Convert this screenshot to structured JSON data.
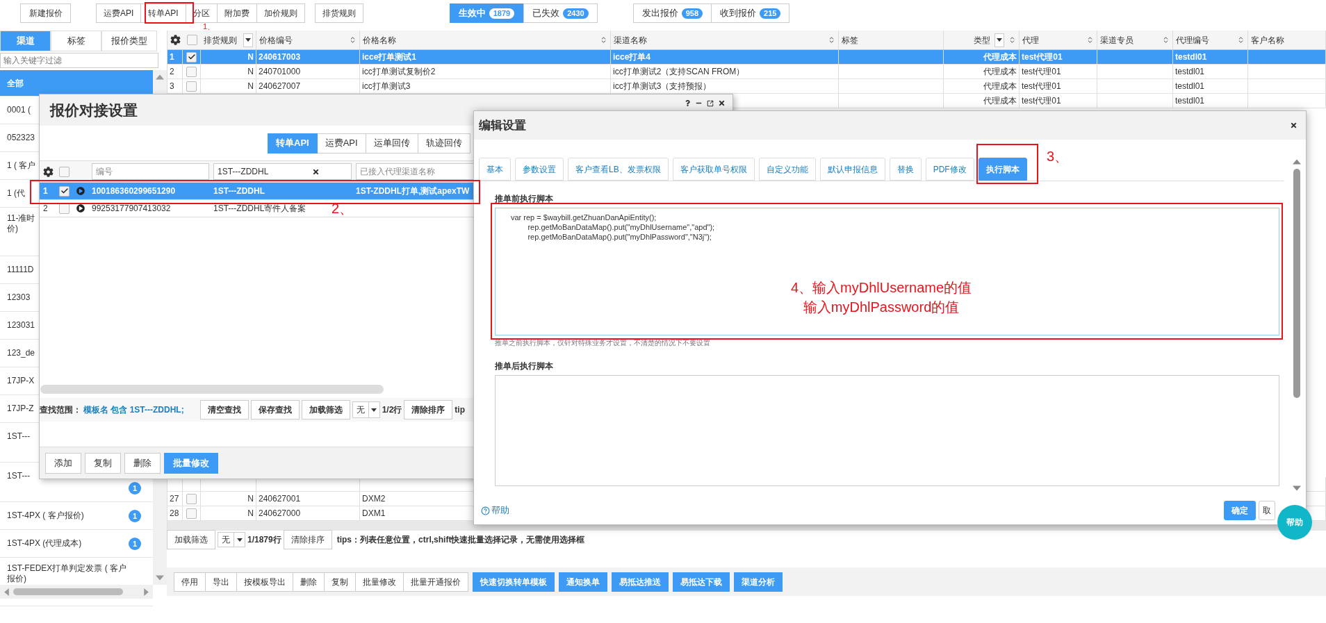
{
  "toolbar": {
    "new_button": "新建报价",
    "api_group": [
      "运费API",
      "转单API",
      "分区",
      "附加费",
      "加价规则"
    ],
    "rules_button": "排货规则",
    "status_toggle": [
      {
        "label": "生效中",
        "count": "1879",
        "selected": true
      },
      {
        "label": "已失效",
        "count": "2430",
        "selected": false
      }
    ],
    "direction_toggle": [
      {
        "label": "发出报价",
        "count": "958"
      },
      {
        "label": "收到报价",
        "count": "215"
      }
    ]
  },
  "sidebar": {
    "tabs": [
      {
        "label": "渠道",
        "selected": true
      },
      {
        "label": "标签",
        "selected": false
      },
      {
        "label": "报价类型",
        "selected": false
      }
    ],
    "filter_placeholder": "输入关键字过滤",
    "items": [
      {
        "lines": [
          "全部"
        ],
        "selected": true
      },
      {
        "lines": [
          "0001 ("
        ],
        "selected": false
      },
      {
        "lines": [
          "052323"
        ],
        "selected": false
      },
      {
        "lines": [
          "1 ( 客户"
        ],
        "selected": false
      },
      {
        "lines": [
          "1 (代"
        ],
        "selected": false
      },
      {
        "lines": [
          "11-准时",
          "价)"
        ],
        "selected": false
      },
      {
        "lines": [
          "11111D"
        ],
        "selected": false
      },
      {
        "lines": [
          "12303"
        ],
        "selected": false
      },
      {
        "lines": [
          "123031"
        ],
        "selected": false
      },
      {
        "lines": [
          "123_de"
        ],
        "selected": false
      },
      {
        "lines": [
          "17JP-X"
        ],
        "selected": false
      },
      {
        "lines": [
          "17JP-Z"
        ],
        "selected": false
      },
      {
        "lines": [
          "1ST---"
        ],
        "selected": false
      },
      {
        "lines": [
          "1ST---"
        ],
        "selected": false,
        "badge": "1"
      },
      {
        "lines": [
          "1ST-4PX ( 客户报价)"
        ],
        "selected": false,
        "badge": "1"
      },
      {
        "lines": [
          "1ST-4PX (代理成本)"
        ],
        "selected": false,
        "badge": "1"
      },
      {
        "lines": [
          "1ST-FEDEX打单判定发票 ( 客户",
          "报价)"
        ],
        "selected": false
      }
    ]
  },
  "main_table": {
    "columns": [
      {
        "label": "排货规则",
        "kind": "filter"
      },
      {
        "label": "价格编号",
        "kind": "sort"
      },
      {
        "label": "价格名称",
        "kind": "sort"
      },
      {
        "label": "渠道名称",
        "kind": "sort"
      },
      {
        "label": "标签",
        "kind": "plain"
      },
      {
        "label": "类型",
        "kind": "filter_sort"
      },
      {
        "label": "代理",
        "kind": "sort"
      },
      {
        "label": "渠道专员",
        "kind": "sort"
      },
      {
        "label": "代理编号",
        "kind": "sort"
      },
      {
        "label": "客户名称",
        "kind": "plain"
      }
    ],
    "rows": [
      {
        "num": "1",
        "checked": true,
        "selected": true,
        "cells": [
          "N",
          "240617003",
          "icce打单测试1",
          "icce打单4",
          null,
          "代理成本",
          "test代理01",
          null,
          "testdl01",
          null
        ]
      },
      {
        "num": "2",
        "checked": false,
        "selected": false,
        "cells": [
          "N",
          "240701000",
          "icc打单测试复制价2",
          "icc打单测试2（支持SCAN FROM）",
          null,
          "代理成本",
          "test代理01",
          null,
          "testdl01",
          null
        ]
      },
      {
        "num": "3",
        "checked": false,
        "selected": false,
        "cells": [
          "N",
          "240627007",
          "icc打单测试3",
          "icc打单测试3（支持预报）",
          null,
          "代理成本",
          "test代理01",
          null,
          "testdl01",
          null
        ]
      },
      {
        "selected": false,
        "cells": [
          null,
          null,
          null,
          null,
          null,
          "代理成本",
          "test代理01",
          null,
          "testdl01",
          null
        ]
      }
    ],
    "header_checked": false,
    "lower_rows": [
      {
        "selected": false,
        "cells": []
      },
      {
        "num": "27",
        "checked": false,
        "selected": false,
        "cells": [
          "N",
          "240627001",
          "DXM2"
        ]
      },
      {
        "num": "28",
        "checked": false,
        "selected": false,
        "cells": [
          "N",
          "240627000",
          "DXM1"
        ]
      }
    ]
  },
  "main_footer": {
    "filter_button": "加载筛选",
    "select": "无",
    "row_count": "1/1879行",
    "sort_button": "清除排序",
    "tips": "tips：列表任意位置，ctrl,shift快速批量选择记录，无需使用选择框"
  },
  "bottom_buttons": [
    {
      "label": "停用",
      "primary": false
    },
    {
      "label": "导出",
      "primary": false
    },
    {
      "label": "按模板导出",
      "primary": false
    },
    {
      "label": "删除",
      "primary": false
    },
    {
      "label": "复制",
      "primary": false
    },
    {
      "label": "批量修改",
      "primary": false
    },
    {
      "label": "批量开通报价",
      "primary": false
    },
    {
      "label": "快速切换转单模板",
      "primary": true
    },
    {
      "label": "通知换单",
      "primary": true
    },
    {
      "label": "易抵达推送",
      "primary": true
    },
    {
      "label": "易抵达下载",
      "primary": true
    },
    {
      "label": "渠道分析",
      "primary": true
    }
  ],
  "quote_dialog": {
    "title": "报价对接设置",
    "tabs": [
      {
        "label": "转单API",
        "selected": true
      },
      {
        "label": "运费API",
        "selected": false
      },
      {
        "label": "运单回传",
        "selected": false
      },
      {
        "label": "轨迹回传",
        "selected": false
      }
    ],
    "header_checked": false,
    "filters": [
      {
        "placeholder": "编号"
      },
      {
        "value": "1ST---ZDDHL"
      },
      {
        "placeholder": "已接入代理渠道名称"
      }
    ],
    "rows": [
      {
        "num": "1",
        "checked": true,
        "selected": true,
        "cells": [
          "100186360299651290",
          "1ST---ZDDHL",
          "1ST-ZDDHL打单,测试apexTW"
        ]
      },
      {
        "num": "2",
        "checked": false,
        "selected": false,
        "cells": [
          "99253177907413032",
          "1ST---ZDDHL寄件人备案",
          null
        ]
      }
    ],
    "search_label": "查找范围：",
    "search_value": "模板名 包含 1ST---ZDDHL;",
    "search_buttons": [
      "清空查找",
      "保存查找",
      "加载筛选"
    ],
    "select": "无",
    "row_count": "1/2行",
    "sort_button": "清除排序",
    "tips": "tip",
    "footer_buttons": [
      {
        "label": "添加",
        "primary": false
      },
      {
        "label": "复制",
        "primary": false
      },
      {
        "label": "删除",
        "primary": false
      },
      {
        "label": "批量修改",
        "primary": true
      }
    ]
  },
  "edit_dialog": {
    "title": "编辑设置",
    "tabs": [
      {
        "label": "基本",
        "selected": false
      },
      {
        "label": "参数设置",
        "selected": false
      },
      {
        "label": "客户查看LB、发票权限",
        "selected": false
      },
      {
        "label": "客户获取单号权限",
        "selected": false
      },
      {
        "label": "自定义功能",
        "selected": false
      },
      {
        "label": "默认申报信息",
        "selected": false
      },
      {
        "label": "替换",
        "selected": false
      },
      {
        "label": "PDF修改",
        "selected": false
      },
      {
        "label": "执行脚本",
        "selected": true
      }
    ],
    "before_label": "推单前执行脚本",
    "before_script": [
      "var rep = $waybill.getZhuanDanApiEntity();",
      "        rep.getMoBanDataMap().put(\"myDhlUsername\",\"apd\");",
      "        rep.getMoBanDataMap().put(\"myDhlPassword\",\"N3j\");"
    ],
    "hint": "推单之前执行脚本，仅针对特殊业务才设置，不清楚的情况下不要设置",
    "after_label": "推单后执行脚本",
    "help_link": "帮助",
    "confirm": "确定",
    "cancel": "取"
  },
  "help_button": "帮助",
  "annotations": [
    {
      "label": "1、"
    },
    {
      "label": "2、"
    },
    {
      "label": "3、"
    },
    {
      "lines": [
        "4、输入myDhlUsername的值",
        "输入myDhlPassword的值"
      ]
    }
  ]
}
